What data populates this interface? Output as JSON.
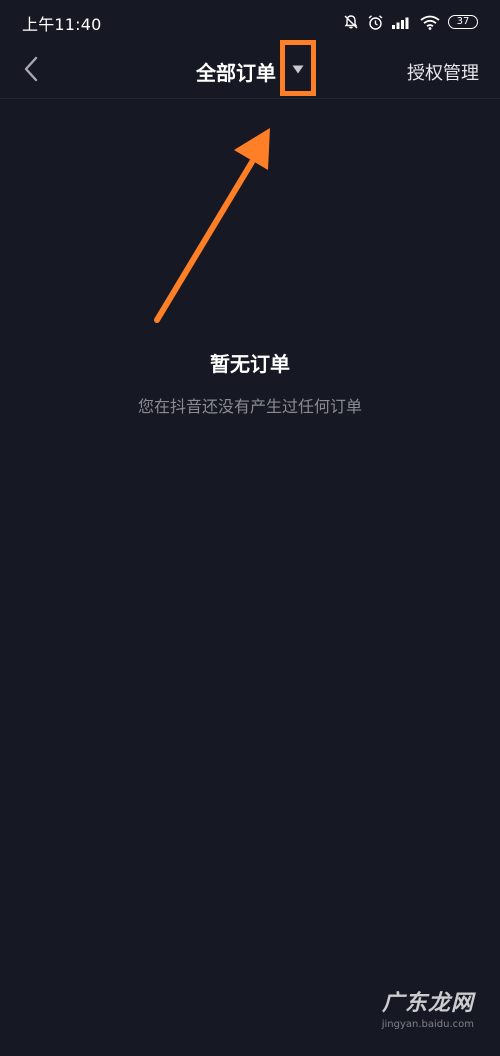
{
  "status_bar": {
    "time": "上午11:40",
    "battery": "37",
    "icons": [
      "bell-off-icon",
      "alarm-icon",
      "signal-icon",
      "wifi-icon",
      "battery-icon"
    ]
  },
  "nav": {
    "back_icon": "chevron-left-icon",
    "title": "全部订单",
    "dropdown_icon": "caret-down-icon",
    "action_label": "授权管理"
  },
  "empty_state": {
    "title": "暂无订单",
    "description": "您在抖音还没有产生过任何订单"
  },
  "annotation": {
    "arrow_color": "#ff7f27",
    "highlight_color": "#ff7f27"
  },
  "watermark": {
    "brand": "广东龙网",
    "url": "jingyan.baidu.com"
  },
  "colors": {
    "background": "#161823",
    "text_primary": "#ffffff",
    "text_secondary": "#8a8b92"
  }
}
